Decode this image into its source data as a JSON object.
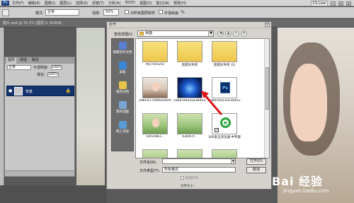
{
  "app": {
    "logo": "Ps",
    "menu": [
      "文件(F)",
      "编辑(E)",
      "图像(I)",
      "图层(L)",
      "选择(S)",
      "滤镜(T)",
      "分析(A)",
      "3D(D)",
      "视图(V)",
      "窗口(W)",
      "帮助(H)"
    ],
    "cs_live": "CS Live"
  },
  "options": {
    "mode_label": "模式:",
    "mode_value": "正常",
    "strength_label": "强度:",
    "strength_value": "50%",
    "sample_all_label": "对所有图层取样",
    "finger_paint_label": "手指绘画"
  },
  "document_tab": "图片.psd @ 33.3% (图层 0, RGB/8)",
  "layers_panel": {
    "tabs": [
      "图层",
      "通道",
      "路径"
    ],
    "blend_mode": "正常",
    "opacity_label": "不透明度:",
    "opacity_value": "100%",
    "fill_label": "填充:",
    "fill_value": "100%",
    "layer_name": "背景"
  },
  "dialog": {
    "title": "打开",
    "lookin_label": "查找范围(I):",
    "lookin_value": "桌面",
    "places": [
      {
        "label": "我最近的文档",
        "icon": "recent-docs-icon",
        "color": "#5b7fd4"
      },
      {
        "label": "桌面",
        "icon": "desktop-icon",
        "color": "#3b86d8"
      },
      {
        "label": "我的文档",
        "icon": "my-documents-icon",
        "color": "#e8c34a"
      },
      {
        "label": "我的电脑",
        "icon": "my-computer-icon",
        "color": "#7aa6d6"
      },
      {
        "label": "网上邻居",
        "icon": "network-icon",
        "color": "#5a9ad8"
      }
    ],
    "files": [
      {
        "name": "My Pictures",
        "kind": "folder"
      },
      {
        "name": "新建文件夹",
        "kind": "folder"
      },
      {
        "name": "新建文件夹 (2)",
        "kind": "folder"
      },
      {
        "name": "2f8d3cc7b0f6d304f5...",
        "kind": "girl"
      },
      {
        "name": "5ab0c9ea35a36d43...",
        "kind": "blue"
      },
      {
        "name": "5ab0c9ea35a36d43...",
        "kind": "psd"
      },
      {
        "name": "59f109b3...",
        "kind": "girl-outdoor"
      },
      {
        "name": "636f07f...",
        "kind": "green"
      },
      {
        "name": "360安全浏览器 中专版",
        "kind": "ie"
      },
      {
        "name": "",
        "kind": "green-small"
      },
      {
        "name": "",
        "kind": "green-small"
      },
      {
        "name": "",
        "kind": "green-small"
      }
    ],
    "filename_label": "文件名(N):",
    "filename_value": "",
    "filetype_label": "文件类型(T):",
    "filetype_value": "所有格式",
    "open_button": "打开(O)",
    "cancel_button": "取消",
    "image_sequence_label": "图像序列",
    "filesize_label": "文件大小:"
  },
  "watermark": {
    "brand": "Bai 经验",
    "url": "jingyan.baidu.com"
  }
}
